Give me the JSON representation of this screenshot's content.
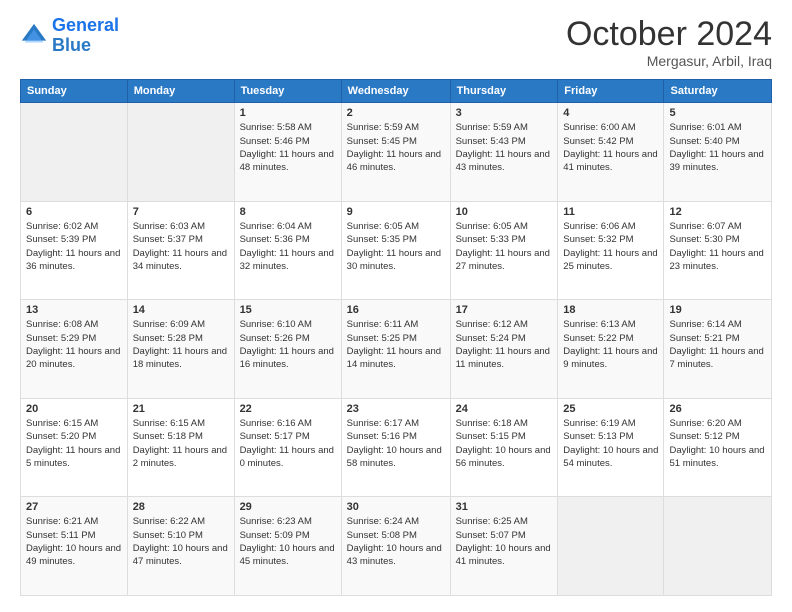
{
  "logo": {
    "line1": "General",
    "line2": "Blue"
  },
  "header": {
    "month": "October 2024",
    "location": "Mergasur, Arbil, Iraq"
  },
  "weekdays": [
    "Sunday",
    "Monday",
    "Tuesday",
    "Wednesday",
    "Thursday",
    "Friday",
    "Saturday"
  ],
  "weeks": [
    [
      {
        "day": "",
        "info": ""
      },
      {
        "day": "",
        "info": ""
      },
      {
        "day": "1",
        "info": "Sunrise: 5:58 AM\nSunset: 5:46 PM\nDaylight: 11 hours and 48 minutes."
      },
      {
        "day": "2",
        "info": "Sunrise: 5:59 AM\nSunset: 5:45 PM\nDaylight: 11 hours and 46 minutes."
      },
      {
        "day": "3",
        "info": "Sunrise: 5:59 AM\nSunset: 5:43 PM\nDaylight: 11 hours and 43 minutes."
      },
      {
        "day": "4",
        "info": "Sunrise: 6:00 AM\nSunset: 5:42 PM\nDaylight: 11 hours and 41 minutes."
      },
      {
        "day": "5",
        "info": "Sunrise: 6:01 AM\nSunset: 5:40 PM\nDaylight: 11 hours and 39 minutes."
      }
    ],
    [
      {
        "day": "6",
        "info": "Sunrise: 6:02 AM\nSunset: 5:39 PM\nDaylight: 11 hours and 36 minutes."
      },
      {
        "day": "7",
        "info": "Sunrise: 6:03 AM\nSunset: 5:37 PM\nDaylight: 11 hours and 34 minutes."
      },
      {
        "day": "8",
        "info": "Sunrise: 6:04 AM\nSunset: 5:36 PM\nDaylight: 11 hours and 32 minutes."
      },
      {
        "day": "9",
        "info": "Sunrise: 6:05 AM\nSunset: 5:35 PM\nDaylight: 11 hours and 30 minutes."
      },
      {
        "day": "10",
        "info": "Sunrise: 6:05 AM\nSunset: 5:33 PM\nDaylight: 11 hours and 27 minutes."
      },
      {
        "day": "11",
        "info": "Sunrise: 6:06 AM\nSunset: 5:32 PM\nDaylight: 11 hours and 25 minutes."
      },
      {
        "day": "12",
        "info": "Sunrise: 6:07 AM\nSunset: 5:30 PM\nDaylight: 11 hours and 23 minutes."
      }
    ],
    [
      {
        "day": "13",
        "info": "Sunrise: 6:08 AM\nSunset: 5:29 PM\nDaylight: 11 hours and 20 minutes."
      },
      {
        "day": "14",
        "info": "Sunrise: 6:09 AM\nSunset: 5:28 PM\nDaylight: 11 hours and 18 minutes."
      },
      {
        "day": "15",
        "info": "Sunrise: 6:10 AM\nSunset: 5:26 PM\nDaylight: 11 hours and 16 minutes."
      },
      {
        "day": "16",
        "info": "Sunrise: 6:11 AM\nSunset: 5:25 PM\nDaylight: 11 hours and 14 minutes."
      },
      {
        "day": "17",
        "info": "Sunrise: 6:12 AM\nSunset: 5:24 PM\nDaylight: 11 hours and 11 minutes."
      },
      {
        "day": "18",
        "info": "Sunrise: 6:13 AM\nSunset: 5:22 PM\nDaylight: 11 hours and 9 minutes."
      },
      {
        "day": "19",
        "info": "Sunrise: 6:14 AM\nSunset: 5:21 PM\nDaylight: 11 hours and 7 minutes."
      }
    ],
    [
      {
        "day": "20",
        "info": "Sunrise: 6:15 AM\nSunset: 5:20 PM\nDaylight: 11 hours and 5 minutes."
      },
      {
        "day": "21",
        "info": "Sunrise: 6:15 AM\nSunset: 5:18 PM\nDaylight: 11 hours and 2 minutes."
      },
      {
        "day": "22",
        "info": "Sunrise: 6:16 AM\nSunset: 5:17 PM\nDaylight: 11 hours and 0 minutes."
      },
      {
        "day": "23",
        "info": "Sunrise: 6:17 AM\nSunset: 5:16 PM\nDaylight: 10 hours and 58 minutes."
      },
      {
        "day": "24",
        "info": "Sunrise: 6:18 AM\nSunset: 5:15 PM\nDaylight: 10 hours and 56 minutes."
      },
      {
        "day": "25",
        "info": "Sunrise: 6:19 AM\nSunset: 5:13 PM\nDaylight: 10 hours and 54 minutes."
      },
      {
        "day": "26",
        "info": "Sunrise: 6:20 AM\nSunset: 5:12 PM\nDaylight: 10 hours and 51 minutes."
      }
    ],
    [
      {
        "day": "27",
        "info": "Sunrise: 6:21 AM\nSunset: 5:11 PM\nDaylight: 10 hours and 49 minutes."
      },
      {
        "day": "28",
        "info": "Sunrise: 6:22 AM\nSunset: 5:10 PM\nDaylight: 10 hours and 47 minutes."
      },
      {
        "day": "29",
        "info": "Sunrise: 6:23 AM\nSunset: 5:09 PM\nDaylight: 10 hours and 45 minutes."
      },
      {
        "day": "30",
        "info": "Sunrise: 6:24 AM\nSunset: 5:08 PM\nDaylight: 10 hours and 43 minutes."
      },
      {
        "day": "31",
        "info": "Sunrise: 6:25 AM\nSunset: 5:07 PM\nDaylight: 10 hours and 41 minutes."
      },
      {
        "day": "",
        "info": ""
      },
      {
        "day": "",
        "info": ""
      }
    ]
  ]
}
